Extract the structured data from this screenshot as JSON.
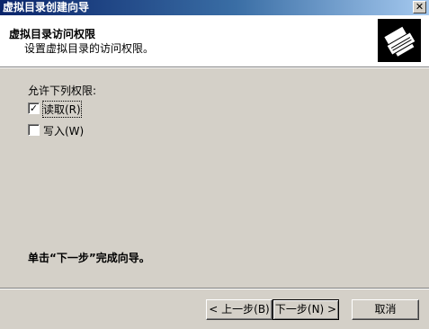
{
  "window": {
    "title": "虚拟目录创建向导",
    "close_label": "✕"
  },
  "header": {
    "title": "虚拟目录访问权限",
    "subtitle": "设置虚拟目录的访问权限。",
    "icon": "wizard-printer-icon"
  },
  "content": {
    "permissions_label": "允许下列权限:",
    "permissions": [
      {
        "label": "读取(R)",
        "checked": true,
        "check_glyph": "✓"
      },
      {
        "label": "写入(W)",
        "checked": false,
        "check_glyph": ""
      }
    ],
    "finish_text": "单击“下一步”完成向导。"
  },
  "buttons": {
    "back": "< 上一步(B)",
    "next": "下一步(N) >",
    "cancel": "取消"
  }
}
